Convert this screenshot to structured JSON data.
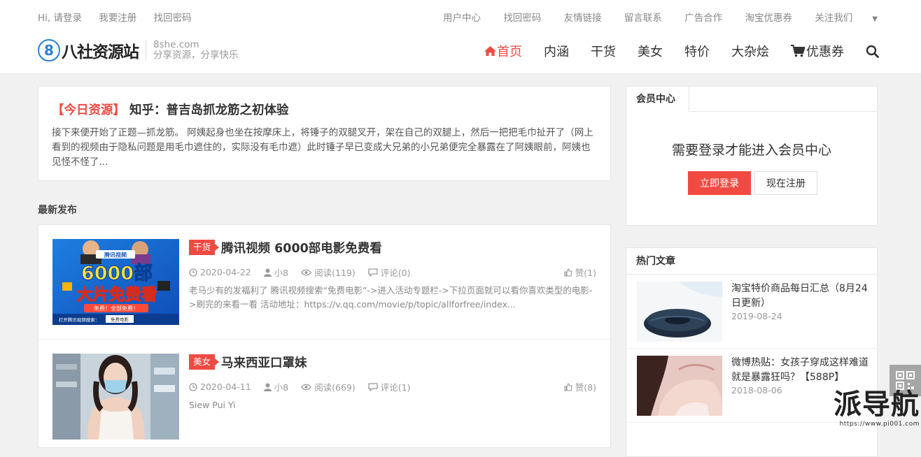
{
  "topbar": {
    "left": [
      "Hi, 请登录",
      "我要注册",
      "找回密码"
    ],
    "right": [
      "用户中心",
      "找回密码",
      "友情链接",
      "留言联系",
      "广告合作",
      "淘宝优惠券",
      "关注我们"
    ]
  },
  "logo": {
    "mark": "8",
    "name": "八社资源站",
    "domain": "8she.com",
    "slogan": "分享资源，分享快乐"
  },
  "nav": [
    "首页",
    "内涵",
    "干货",
    "美女",
    "特价",
    "大杂烩",
    "优惠券"
  ],
  "today": {
    "tag": "【今日资源】",
    "title": "知乎：普吉岛抓龙筋之初体验",
    "text": "接下来便开始了正题—抓龙筋。 阿姨起身也坐在按摩床上，将锤子的双腿叉开，架在自己的双腿上，然后一把把毛巾扯开了（网上看到的视频由于隐私问题是用毛巾遮住的，实际没有毛巾遮）此时锤子早已变成大兄弟的小兄弟便完全暴露在了阿姨眼前，阿姨也见怪不怪了..."
  },
  "latest_title": "最新发布",
  "posts": [
    {
      "cat": "干货",
      "title": "腾讯视频 6000部电影免费看",
      "date": "2020-04-22",
      "author": "小8",
      "reads": "阅读(119)",
      "comments": "评论(0)",
      "likes": "赞(1)",
      "excerpt": "老马少有的发福利了 腾讯视频搜索“免费电影”->进入活动专题栏->下拉页面就可以看你喜欢类型的电影->刷完的来看一看 活动地址：https://v.qq.com/movie/p/topic/allforfree/index...",
      "thumb": {
        "line1": "腾讯视频",
        "big1": "6000部",
        "big2": "大片免费看",
        "small": "免费！全部免费！",
        "bottom": "打开腾讯视频搜索：",
        "btn": "免费电影"
      }
    },
    {
      "cat": "美女",
      "title": "马来西亚口罩妹",
      "date": "2020-04-11",
      "author": "小8",
      "reads": "阅读(669)",
      "comments": "评论(1)",
      "likes": "赞(8)",
      "excerpt": "Siew Pui Yi"
    }
  ],
  "sidebar": {
    "member_tab": "会员中心",
    "member_msg": "需要登录才能进入会员中心",
    "login": "立即登录",
    "register": "现在注册",
    "hot_title": "热门文章",
    "hot": [
      {
        "title": "淘宝特价商品每日汇总（8月24日更新）",
        "date": "2019-08-24"
      },
      {
        "title": "微博热贴：女孩子穿成这样难道就是暴露狂吗？【588P】",
        "date": "2018-08-06"
      }
    ]
  },
  "watermark": {
    "big": "派导航",
    "small": "https://www.pi001.com"
  },
  "colors": {
    "accent": "#f14a42",
    "logo_blue": "#2b7fd8"
  }
}
